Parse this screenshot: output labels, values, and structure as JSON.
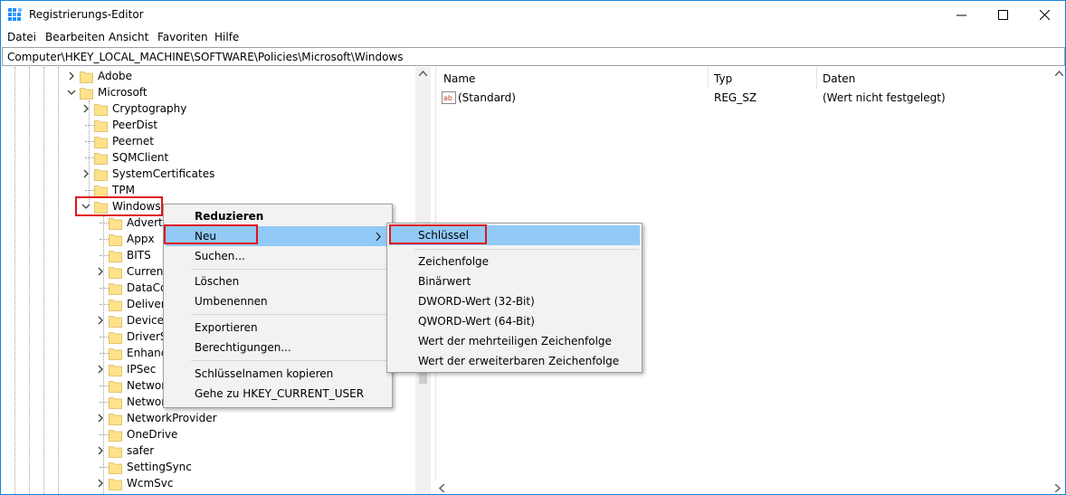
{
  "window": {
    "title": "Registrierungs-Editor"
  },
  "window_controls": {
    "minimize": "—",
    "maximize": "☐",
    "close": "✕"
  },
  "menu": [
    "Datei",
    "Bearbeiten",
    "Ansicht",
    "Favoriten",
    "Hilfe"
  ],
  "address": "Computer\\HKEY_LOCAL_MACHINE\\SOFTWARE\\Policies\\Microsoft\\Windows",
  "tree": {
    "level1": [
      {
        "label": "Adobe",
        "expander": "collapsed"
      },
      {
        "label": "Microsoft",
        "expander": "expanded"
      }
    ],
    "level2": [
      {
        "label": "Cryptography",
        "expander": "collapsed"
      },
      {
        "label": "PeerDist",
        "expander": "none"
      },
      {
        "label": "Peernet",
        "expander": "none"
      },
      {
        "label": "SQMClient",
        "expander": "none"
      },
      {
        "label": "SystemCertificates",
        "expander": "collapsed"
      },
      {
        "label": "TPM",
        "expander": "none"
      },
      {
        "label": "Windows",
        "expander": "expanded"
      }
    ],
    "level3": [
      {
        "label": "Advertis",
        "expander": "none"
      },
      {
        "label": "Appx",
        "expander": "none"
      },
      {
        "label": "BITS",
        "expander": "none"
      },
      {
        "label": "Current",
        "expander": "collapsed"
      },
      {
        "label": "DataCo",
        "expander": "none"
      },
      {
        "label": "Delivery",
        "expander": "none"
      },
      {
        "label": "Devicel",
        "expander": "collapsed"
      },
      {
        "label": "DriverSe",
        "expander": "none"
      },
      {
        "label": "Enhanc",
        "expander": "none"
      },
      {
        "label": "IPSec",
        "expander": "collapsed"
      },
      {
        "label": "Networ",
        "expander": "none"
      },
      {
        "label": "Networ",
        "expander": "none"
      },
      {
        "label": "NetworkProvider",
        "expander": "collapsed"
      },
      {
        "label": "OneDrive",
        "expander": "none"
      },
      {
        "label": "safer",
        "expander": "collapsed"
      },
      {
        "label": "SettingSync",
        "expander": "none"
      },
      {
        "label": "WcmSvc",
        "expander": "collapsed"
      }
    ]
  },
  "list": {
    "columns": [
      "Name",
      "Typ",
      "Daten"
    ],
    "rows": [
      {
        "icon": "ab",
        "name": "(Standard)",
        "type": "REG_SZ",
        "data": "(Wert nicht festgelegt)"
      }
    ]
  },
  "context_menu": {
    "items": [
      {
        "label": "Reduzieren",
        "bold": true
      },
      {
        "label": "Neu",
        "selected": true,
        "submenu": true
      },
      {
        "label": "Suchen..."
      },
      {
        "label": "Löschen"
      },
      {
        "label": "Umbenennen"
      },
      {
        "label": "Exportieren"
      },
      {
        "label": "Berechtigungen..."
      },
      {
        "label": "Schlüsselnamen kopieren"
      },
      {
        "label": "Gehe zu HKEY_CURRENT_USER"
      }
    ]
  },
  "submenu": {
    "items": [
      {
        "label": "Schlüssel",
        "selected": true
      },
      {
        "label": "Zeichenfolge"
      },
      {
        "label": "Binärwert"
      },
      {
        "label": "DWORD-Wert (32-Bit)"
      },
      {
        "label": "QWORD-Wert (64-Bit)"
      },
      {
        "label": "Wert der mehrteiligen Zeichenfolge"
      },
      {
        "label": "Wert der erweiterbaren Zeichenfolge"
      }
    ]
  },
  "colors": {
    "highlight_box": "#e0141b",
    "selection": "#91c9f7",
    "folder": "#ffe28a",
    "window_border": "#1883d7"
  }
}
